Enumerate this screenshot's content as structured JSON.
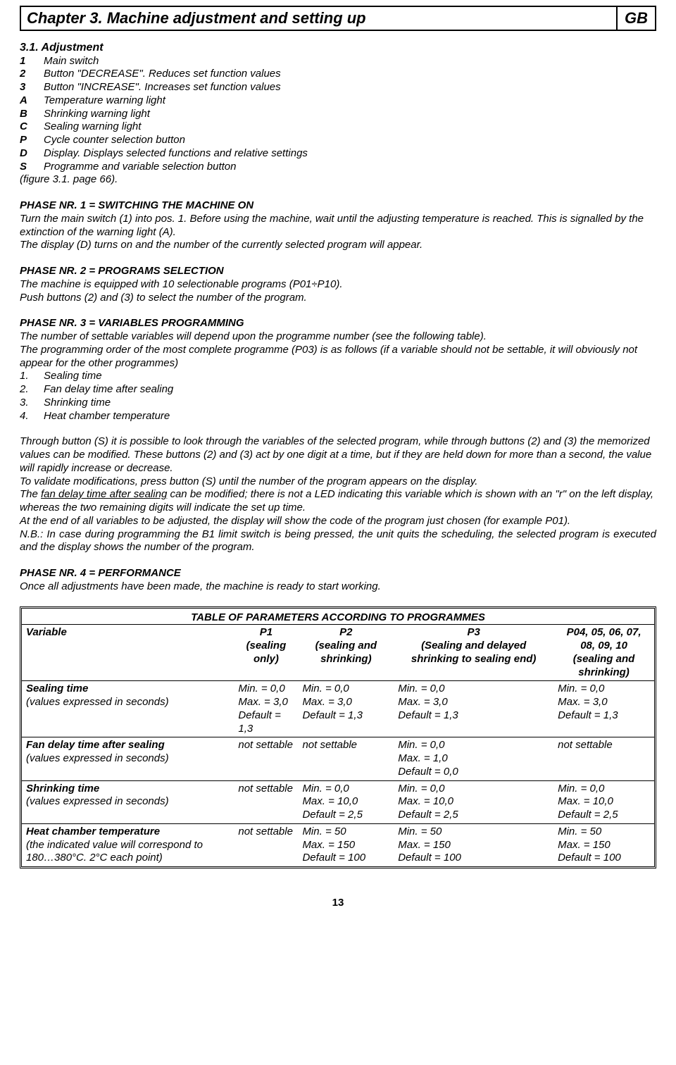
{
  "header": {
    "chapter": "Chapter 3. Machine adjustment and setting up",
    "lang": "GB"
  },
  "section_title": "3.1. Adjustment",
  "legend": [
    {
      "key": "1",
      "text": "Main switch"
    },
    {
      "key": "2",
      "text": "Button \"DECREASE\". Reduces set function values"
    },
    {
      "key": "3",
      "text": "Button \"INCREASE\". Increases set function values"
    },
    {
      "key": "A",
      "text": "Temperature warning light"
    },
    {
      "key": "B",
      "text": "Shrinking warning light"
    },
    {
      "key": "C",
      "text": "Sealing warning light"
    },
    {
      "key": "P",
      "text": "Cycle counter selection button"
    },
    {
      "key": "D",
      "text": "Display. Displays selected functions and relative settings"
    },
    {
      "key": "S",
      "text": "Programme and variable selection button"
    }
  ],
  "figure_note": "(figure 3.1. page 66).",
  "phase1": {
    "heading": "PHASE NR. 1 = SWITCHING THE MACHINE ON",
    "p1": "Turn the main switch (1) into pos. 1. Before using the machine, wait until the adjusting temperature is reached. This is signalled by the extinction of the warning light (A).",
    "p2": "The display (D) turns on and the number of the currently selected program will appear."
  },
  "phase2": {
    "heading": "PHASE NR. 2 = PROGRAMS SELECTION",
    "p1": "The machine is equipped with 10 selectionable programs (P01÷P10).",
    "p2": "Push buttons (2) and (3) to select the number of the program."
  },
  "phase3": {
    "heading": "PHASE NR. 3 = VARIABLES PROGRAMMING",
    "p1": "The number of settable variables will depend upon the programme number (see the following table).",
    "p2": "The programming order of the most complete programme (P03) is as follows (if a variable should not be settable, it will obviously not appear for the other programmes)",
    "items": [
      "Sealing time",
      "Fan delay time after sealing",
      "Shrinking time",
      "Heat chamber temperature"
    ],
    "p3": "Through button (S) it is possible to look through the variables of the selected program, while through buttons (2) and (3) the memorized values can be modified. These buttons (2) and (3) act by one digit at a time, but if they are held down for more than a second, the value will rapidly increase or decrease.",
    "p4": "To validate modifications, press button (S) until the number of the program appears on the display.",
    "p5a": "The ",
    "p5u": "fan delay time after sealing",
    "p5b": " can be modified; there is not a LED indicating this variable which is shown with an \"r\" on the left display, whereas the two remaining digits will indicate the set up time.",
    "p6": "At the end of all variables to be adjusted, the display will show the code of the program just chosen (for example P01).",
    "p7": "N.B.: In case during programming the B1 limit switch is being pressed, the unit quits the scheduling, the selected program is executed and the display shows the number of the program."
  },
  "phase4": {
    "heading": "PHASE NR. 4 = PERFORMANCE",
    "p1": "Once all adjustments have been made, the machine is ready to start working."
  },
  "table": {
    "title": "TABLE OF PARAMETERS ACCORDING TO PROGRAMMES",
    "var_label": "Variable",
    "cols": [
      {
        "h1": "P1",
        "h2": "(sealing only)"
      },
      {
        "h1": "P2",
        "h2": "(sealing and shrinking)"
      },
      {
        "h1": "P3",
        "h2": "(Sealing and delayed shrinking to sealing end)"
      },
      {
        "h1": "P04, 05, 06, 07, 08, 09, 10",
        "h2": "(sealing and shrinking)"
      }
    ],
    "rows": [
      {
        "label": "Sealing time",
        "sub": "(values expressed in seconds)",
        "cells": [
          "Min. = 0,0\nMax. = 3,0\nDefault = 1,3",
          "Min. = 0,0\nMax. = 3,0\nDefault = 1,3",
          "Min. = 0,0\nMax. = 3,0\nDefault = 1,3",
          "Min. = 0,0\nMax. = 3,0\nDefault = 1,3"
        ]
      },
      {
        "label": "Fan delay time after sealing",
        "sub": "(values expressed in seconds)",
        "cells": [
          "not settable",
          "not settable",
          "Min. = 0,0\nMax. = 1,0\nDefault = 0,0",
          "not settable"
        ]
      },
      {
        "label": "Shrinking time",
        "sub": "(values expressed in seconds)",
        "cells": [
          "not settable",
          "Min. = 0,0\nMax. = 10,0\nDefault = 2,5",
          "Min. = 0,0\nMax. = 10,0\nDefault = 2,5",
          "Min. = 0,0\nMax. = 10,0\nDefault = 2,5"
        ]
      },
      {
        "label": "Heat chamber temperature",
        "sub": "(the indicated value will correspond to 180…380°C. 2°C each point)",
        "cells": [
          "not settable",
          "Min. = 50\nMax. = 150\nDefault = 100",
          "Min. = 50\nMax. = 150\nDefault = 100",
          "Min. = 50\nMax. = 150\nDefault = 100"
        ]
      }
    ]
  },
  "page_number": "13"
}
